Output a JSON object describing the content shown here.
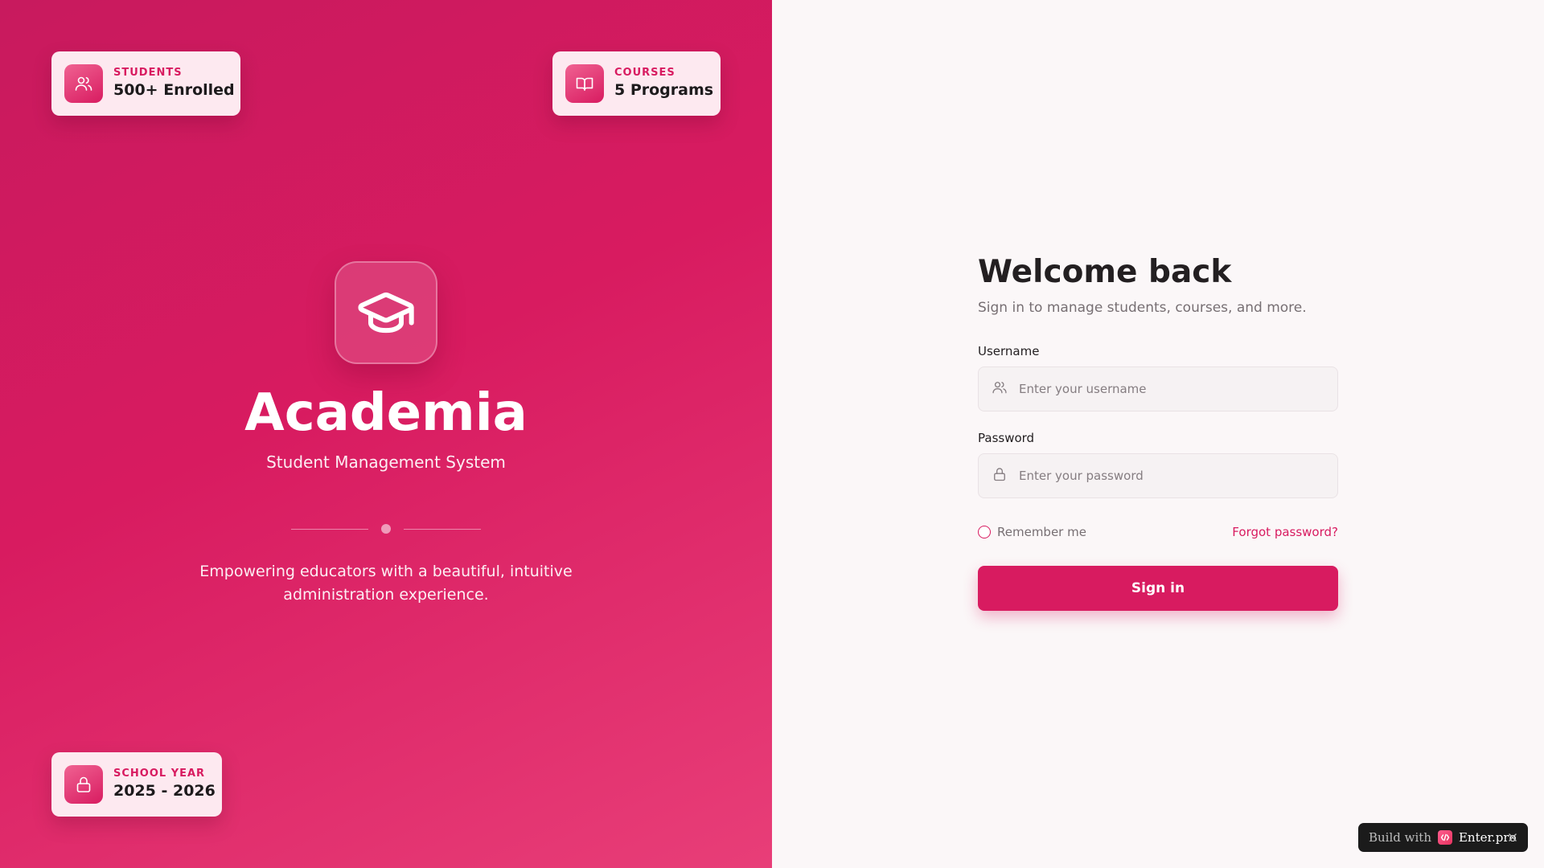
{
  "brand": {
    "app_name": "Academia",
    "subtitle": "Student Management System",
    "tagline": "Empowering educators with a beautiful, intuitive administration experience.",
    "logo_icon": "graduation-cap-icon"
  },
  "stats": [
    {
      "label": "STUDENTS",
      "value": "500+ Enrolled",
      "icon": "users-icon"
    },
    {
      "label": "COURSES",
      "value": "5 Programs",
      "icon": "book-open-icon"
    },
    {
      "label": "SCHOOL YEAR",
      "value": "2025 - 2026",
      "icon": "lock-icon"
    }
  ],
  "login": {
    "title": "Welcome back",
    "subtitle": "Sign in to manage students, courses, and more.",
    "username": {
      "label": "Username",
      "placeholder": "Enter your username",
      "value": ""
    },
    "password": {
      "label": "Password",
      "placeholder": "Enter your password",
      "value": ""
    },
    "remember_label": "Remember me",
    "remember_checked": false,
    "forgot_label": "Forgot password?",
    "signin_label": "Sign in"
  },
  "badge": {
    "prefix": "Build with",
    "brand": "Enter.pro"
  },
  "colors": {
    "accent": "#d81b60",
    "panel_gradient_start": "#c81a5e",
    "panel_gradient_end": "#e83e78",
    "background": "#fbf7f8"
  }
}
